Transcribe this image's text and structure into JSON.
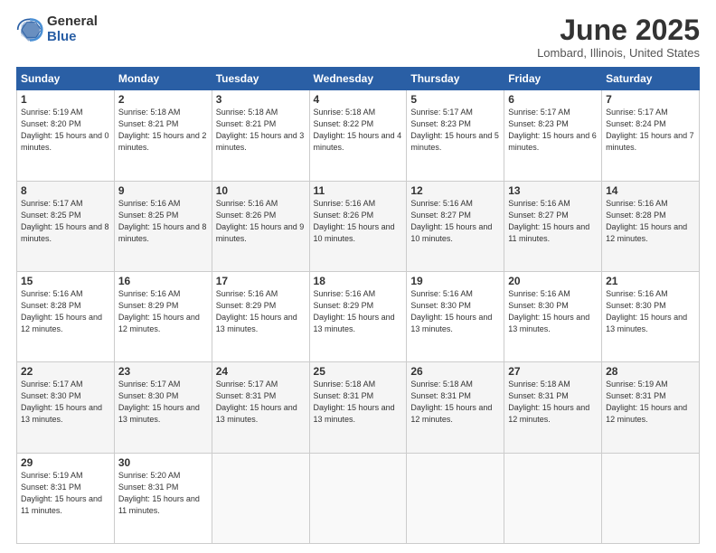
{
  "logo": {
    "general": "General",
    "blue": "Blue"
  },
  "title": "June 2025",
  "location": "Lombard, Illinois, United States",
  "days_header": [
    "Sunday",
    "Monday",
    "Tuesday",
    "Wednesday",
    "Thursday",
    "Friday",
    "Saturday"
  ],
  "weeks": [
    [
      {
        "day": "1",
        "sunrise": "5:19 AM",
        "sunset": "8:20 PM",
        "daylight": "15 hours and 0 minutes."
      },
      {
        "day": "2",
        "sunrise": "5:18 AM",
        "sunset": "8:21 PM",
        "daylight": "15 hours and 2 minutes."
      },
      {
        "day": "3",
        "sunrise": "5:18 AM",
        "sunset": "8:21 PM",
        "daylight": "15 hours and 3 minutes."
      },
      {
        "day": "4",
        "sunrise": "5:18 AM",
        "sunset": "8:22 PM",
        "daylight": "15 hours and 4 minutes."
      },
      {
        "day": "5",
        "sunrise": "5:17 AM",
        "sunset": "8:23 PM",
        "daylight": "15 hours and 5 minutes."
      },
      {
        "day": "6",
        "sunrise": "5:17 AM",
        "sunset": "8:23 PM",
        "daylight": "15 hours and 6 minutes."
      },
      {
        "day": "7",
        "sunrise": "5:17 AM",
        "sunset": "8:24 PM",
        "daylight": "15 hours and 7 minutes."
      }
    ],
    [
      {
        "day": "8",
        "sunrise": "5:17 AM",
        "sunset": "8:25 PM",
        "daylight": "15 hours and 8 minutes."
      },
      {
        "day": "9",
        "sunrise": "5:16 AM",
        "sunset": "8:25 PM",
        "daylight": "15 hours and 8 minutes."
      },
      {
        "day": "10",
        "sunrise": "5:16 AM",
        "sunset": "8:26 PM",
        "daylight": "15 hours and 9 minutes."
      },
      {
        "day": "11",
        "sunrise": "5:16 AM",
        "sunset": "8:26 PM",
        "daylight": "15 hours and 10 minutes."
      },
      {
        "day": "12",
        "sunrise": "5:16 AM",
        "sunset": "8:27 PM",
        "daylight": "15 hours and 10 minutes."
      },
      {
        "day": "13",
        "sunrise": "5:16 AM",
        "sunset": "8:27 PM",
        "daylight": "15 hours and 11 minutes."
      },
      {
        "day": "14",
        "sunrise": "5:16 AM",
        "sunset": "8:28 PM",
        "daylight": "15 hours and 12 minutes."
      }
    ],
    [
      {
        "day": "15",
        "sunrise": "5:16 AM",
        "sunset": "8:28 PM",
        "daylight": "15 hours and 12 minutes."
      },
      {
        "day": "16",
        "sunrise": "5:16 AM",
        "sunset": "8:29 PM",
        "daylight": "15 hours and 12 minutes."
      },
      {
        "day": "17",
        "sunrise": "5:16 AM",
        "sunset": "8:29 PM",
        "daylight": "15 hours and 13 minutes."
      },
      {
        "day": "18",
        "sunrise": "5:16 AM",
        "sunset": "8:29 PM",
        "daylight": "15 hours and 13 minutes."
      },
      {
        "day": "19",
        "sunrise": "5:16 AM",
        "sunset": "8:30 PM",
        "daylight": "15 hours and 13 minutes."
      },
      {
        "day": "20",
        "sunrise": "5:16 AM",
        "sunset": "8:30 PM",
        "daylight": "15 hours and 13 minutes."
      },
      {
        "day": "21",
        "sunrise": "5:16 AM",
        "sunset": "8:30 PM",
        "daylight": "15 hours and 13 minutes."
      }
    ],
    [
      {
        "day": "22",
        "sunrise": "5:17 AM",
        "sunset": "8:30 PM",
        "daylight": "15 hours and 13 minutes."
      },
      {
        "day": "23",
        "sunrise": "5:17 AM",
        "sunset": "8:30 PM",
        "daylight": "15 hours and 13 minutes."
      },
      {
        "day": "24",
        "sunrise": "5:17 AM",
        "sunset": "8:31 PM",
        "daylight": "15 hours and 13 minutes."
      },
      {
        "day": "25",
        "sunrise": "5:18 AM",
        "sunset": "8:31 PM",
        "daylight": "15 hours and 13 minutes."
      },
      {
        "day": "26",
        "sunrise": "5:18 AM",
        "sunset": "8:31 PM",
        "daylight": "15 hours and 12 minutes."
      },
      {
        "day": "27",
        "sunrise": "5:18 AM",
        "sunset": "8:31 PM",
        "daylight": "15 hours and 12 minutes."
      },
      {
        "day": "28",
        "sunrise": "5:19 AM",
        "sunset": "8:31 PM",
        "daylight": "15 hours and 12 minutes."
      }
    ],
    [
      {
        "day": "29",
        "sunrise": "5:19 AM",
        "sunset": "8:31 PM",
        "daylight": "15 hours and 11 minutes."
      },
      {
        "day": "30",
        "sunrise": "5:20 AM",
        "sunset": "8:31 PM",
        "daylight": "15 hours and 11 minutes."
      },
      null,
      null,
      null,
      null,
      null
    ]
  ],
  "labels": {
    "sunrise": "Sunrise:",
    "sunset": "Sunset:",
    "daylight": "Daylight:"
  }
}
